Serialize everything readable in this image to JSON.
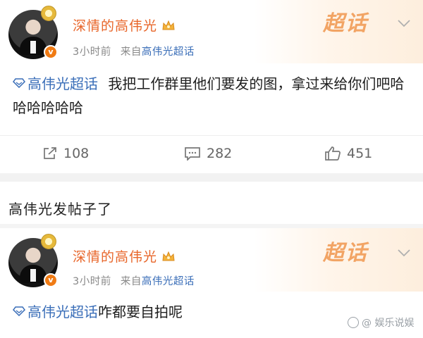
{
  "posts": [
    {
      "username": "深情的高伟光",
      "time": "3小时前",
      "source_prefix": "来自",
      "source": "高伟光超话",
      "badge_text": "超话",
      "topic": "高伟光超话",
      "text": "我把工作群里他们要发的图，拿过来给你们吧哈哈哈哈哈哈",
      "actions": {
        "repost": "108",
        "comment": "282",
        "like": "451"
      }
    },
    {
      "username": "深情的高伟光",
      "time": "3小时前",
      "source_prefix": "来自",
      "source": "高伟光超话",
      "badge_text": "超话",
      "topic": "高伟光超话",
      "text": "咋都要自拍呢"
    }
  ],
  "caption": "高伟光发帖子了",
  "watermark": "@ 娱乐说娱",
  "colors": {
    "username": "#e8662a",
    "link": "#3a6eb8",
    "badge": "#f2a464",
    "muted": "#888888",
    "verified": "#f07b14"
  },
  "icons": {
    "verified": "v-badge-icon",
    "crown": "crown-icon",
    "topic": "diamond-topic-icon",
    "repost": "share-icon",
    "comment": "comment-icon",
    "like": "thumbs-up-icon",
    "menu": "chevron-down-icon"
  }
}
